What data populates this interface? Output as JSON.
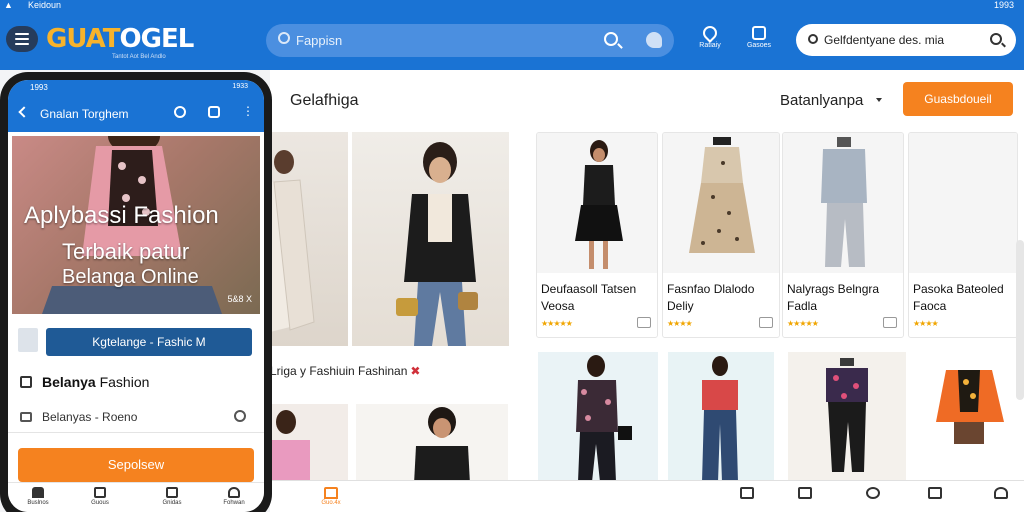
{
  "status_bar": {
    "left_text": "Keidoun",
    "right_text": "1993",
    "phone_left": "1993",
    "phone_right": "1933"
  },
  "header": {
    "logo_part1": "GUAT",
    "logo_part2": "OGEL",
    "logo_tagline": "Tantot Aot Bel Andlo",
    "search_placeholder": "Fappisn",
    "icon_1_label": "Ratiaiy",
    "icon_2_label": "Gasoes",
    "search2_text": "Gelfdentyane des. mia"
  },
  "main": {
    "section_title": "Gelafhiga",
    "sort_label": "Batanlyanpa",
    "cta_label": "Guasbdoueil",
    "caption": "Lriga y Fashiuin Fashinan",
    "caption_mark": "✖",
    "products": [
      {
        "title": "Deufaasoll Tatsen Veosa",
        "stars": "★★★★★"
      },
      {
        "title": "Fasnfao Dlalodo Deliy",
        "stars": "★★★★"
      },
      {
        "title": "Nalyrags  Belngra Fadla",
        "stars": "★★★★★"
      },
      {
        "title": "Pasoka Bateoled Faoca",
        "stars": "★★★★"
      }
    ]
  },
  "bottom_nav": {
    "home_label": "Guo.4x"
  },
  "phone": {
    "title": "Gnalan Torghem",
    "banner_line1": "Aplybassi Fashion",
    "banner_line2": "Terbaik patur",
    "banner_line3": "Belanga Online",
    "banner_page": "5&8 X",
    "chip_label": "Kgtelange - Fashic M",
    "row1_bold": "Belanya",
    "row1_rest": "Fashion",
    "row2_text": "Belanyas - Roeno",
    "cta_label": "Sepolsew",
    "nav": [
      "Buslnos",
      "Guous",
      "Gnidas",
      "Fohwan"
    ]
  },
  "colors": {
    "brand_blue": "#1a73d4",
    "accent_orange": "#f5821f",
    "logo_yellow": "#f7b32b",
    "chip_navy": "#1f5a96"
  }
}
